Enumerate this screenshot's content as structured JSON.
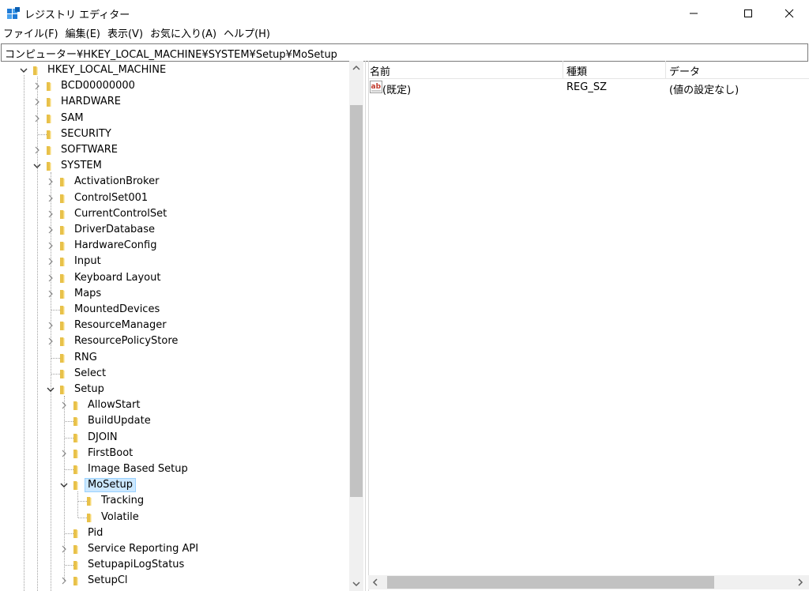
{
  "window": {
    "title": "レジストリ エディター"
  },
  "menu": [
    {
      "label": "ファイル(F)"
    },
    {
      "label": "編集(E)"
    },
    {
      "label": "表示(V)"
    },
    {
      "label": "お気に入り(A)"
    },
    {
      "label": "ヘルプ(H)"
    }
  ],
  "address": {
    "path": "コンピューター¥HKEY_LOCAL_MACHINE¥SYSTEM¥Setup¥MoSetup"
  },
  "tree": [
    {
      "label": "HKEY_LOCAL_MACHINE",
      "level": 0,
      "state": "expanded"
    },
    {
      "label": "BCD00000000",
      "level": 1,
      "state": "collapsed"
    },
    {
      "label": "HARDWARE",
      "level": 1,
      "state": "collapsed"
    },
    {
      "label": "SAM",
      "level": 1,
      "state": "collapsed"
    },
    {
      "label": "SECURITY",
      "level": 1,
      "state": "leaf"
    },
    {
      "label": "SOFTWARE",
      "level": 1,
      "state": "collapsed"
    },
    {
      "label": "SYSTEM",
      "level": 1,
      "state": "expanded"
    },
    {
      "label": "ActivationBroker",
      "level": 2,
      "state": "collapsed"
    },
    {
      "label": "ControlSet001",
      "level": 2,
      "state": "collapsed"
    },
    {
      "label": "CurrentControlSet",
      "level": 2,
      "state": "collapsed"
    },
    {
      "label": "DriverDatabase",
      "level": 2,
      "state": "collapsed"
    },
    {
      "label": "HardwareConfig",
      "level": 2,
      "state": "collapsed"
    },
    {
      "label": "Input",
      "level": 2,
      "state": "collapsed"
    },
    {
      "label": "Keyboard Layout",
      "level": 2,
      "state": "collapsed"
    },
    {
      "label": "Maps",
      "level": 2,
      "state": "collapsed"
    },
    {
      "label": "MountedDevices",
      "level": 2,
      "state": "leaf"
    },
    {
      "label": "ResourceManager",
      "level": 2,
      "state": "collapsed"
    },
    {
      "label": "ResourcePolicyStore",
      "level": 2,
      "state": "collapsed"
    },
    {
      "label": "RNG",
      "level": 2,
      "state": "leaf"
    },
    {
      "label": "Select",
      "level": 2,
      "state": "leaf"
    },
    {
      "label": "Setup",
      "level": 2,
      "state": "expanded"
    },
    {
      "label": "AllowStart",
      "level": 3,
      "state": "collapsed"
    },
    {
      "label": "BuildUpdate",
      "level": 3,
      "state": "leaf"
    },
    {
      "label": "DJOIN",
      "level": 3,
      "state": "leaf"
    },
    {
      "label": "FirstBoot",
      "level": 3,
      "state": "collapsed"
    },
    {
      "label": "Image Based Setup",
      "level": 3,
      "state": "leaf"
    },
    {
      "label": "MoSetup",
      "level": 3,
      "state": "expanded",
      "selected": true
    },
    {
      "label": "Tracking",
      "level": 4,
      "state": "leaf"
    },
    {
      "label": "Volatile",
      "level": 4,
      "state": "leaf"
    },
    {
      "label": "Pid",
      "level": 3,
      "state": "leaf"
    },
    {
      "label": "Service Reporting API",
      "level": 3,
      "state": "collapsed"
    },
    {
      "label": "SetupapiLogStatus",
      "level": 3,
      "state": "leaf"
    },
    {
      "label": "SetupCl",
      "level": 3,
      "state": "collapsed"
    }
  ],
  "list": {
    "columns": [
      "名前",
      "種類",
      "データ"
    ],
    "rows": [
      {
        "name": "(既定)",
        "type": "REG_SZ",
        "data": "(値の設定なし)"
      }
    ]
  },
  "colors": {
    "folder": "#e8c14a",
    "selection_bg": "#cce8ff",
    "scroll_thumb": "#c2c2c2"
  }
}
